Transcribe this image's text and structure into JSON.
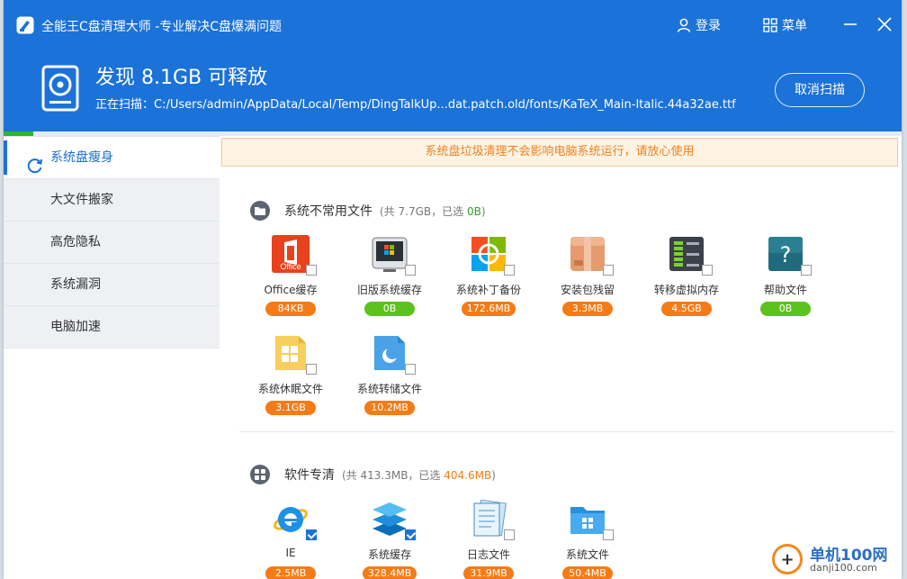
{
  "app": {
    "title": "全能王C盘清理大师  -专业解决C盘爆满问题",
    "login_label": "登录",
    "menu_label": "菜单"
  },
  "scan": {
    "found_text": "发现 8.1GB 可释放",
    "scanning_text": "正在扫描：C:/Users/admin/AppData/Local/Temp/DingTalkUp...dat.patch.old/fonts/KaTeX_Main-Italic.44a32ae.ttf",
    "cancel_label": "取消扫描",
    "progress": 0.033
  },
  "sidebar": {
    "items": [
      {
        "label": "系统盘瘦身"
      },
      {
        "label": "大文件搬家"
      },
      {
        "label": "高危隐私"
      },
      {
        "label": "系统漏洞"
      },
      {
        "label": "电脑加速"
      }
    ]
  },
  "notice": "系统盘垃圾清理不会影响电脑系统运行，请放心使用",
  "sections": [
    {
      "title": "系统不常用文件",
      "meta": "(共 7.7GB，已选 ",
      "selected": "0B",
      "meta_end": ")",
      "items": [
        {
          "label": "Office缓存",
          "size": "84KB",
          "checked": false,
          "icon": "office-icon"
        },
        {
          "label": "旧版系统缓存",
          "size": "0B",
          "checked": false,
          "icon": "old-system-icon"
        },
        {
          "label": "系统补丁备份",
          "size": "172.6MB",
          "checked": false,
          "icon": "windows-patch-icon"
        },
        {
          "label": "安装包残留",
          "size": "3.3MB",
          "checked": false,
          "icon": "package-box-icon"
        },
        {
          "label": "转移虚拟内存",
          "size": "4.5GB",
          "checked": false,
          "icon": "memory-chip-icon"
        },
        {
          "label": "帮助文件",
          "size": "0B",
          "checked": false,
          "icon": "help-icon"
        },
        {
          "label": "系统休眠文件",
          "size": "3.1GB",
          "checked": false,
          "icon": "hibernate-file-icon"
        },
        {
          "label": "系统转储文件",
          "size": "10.2MB",
          "checked": false,
          "icon": "dump-file-icon"
        }
      ]
    },
    {
      "title": "软件专清",
      "meta": "(共 413.3MB，已选 ",
      "selected": "404.6MB",
      "meta_end": ")",
      "items": [
        {
          "label": "IE",
          "size": "2.5MB",
          "checked": true,
          "icon": "ie-icon"
        },
        {
          "label": "系统缓存",
          "size": "328.4MB",
          "checked": true,
          "icon": "layers-icon"
        },
        {
          "label": "日志文件",
          "size": "31.9MB",
          "checked": false,
          "icon": "log-file-icon"
        },
        {
          "label": "系统文件",
          "size": "50.4MB",
          "checked": false,
          "icon": "system-folder-icon"
        }
      ]
    }
  ],
  "watermark": {
    "line1": "单机100网",
    "line2": "danji100.com"
  },
  "colors": {
    "header": "#1b72d8",
    "accent_orange": "#f47b16",
    "accent_green": "#5cc21e"
  }
}
